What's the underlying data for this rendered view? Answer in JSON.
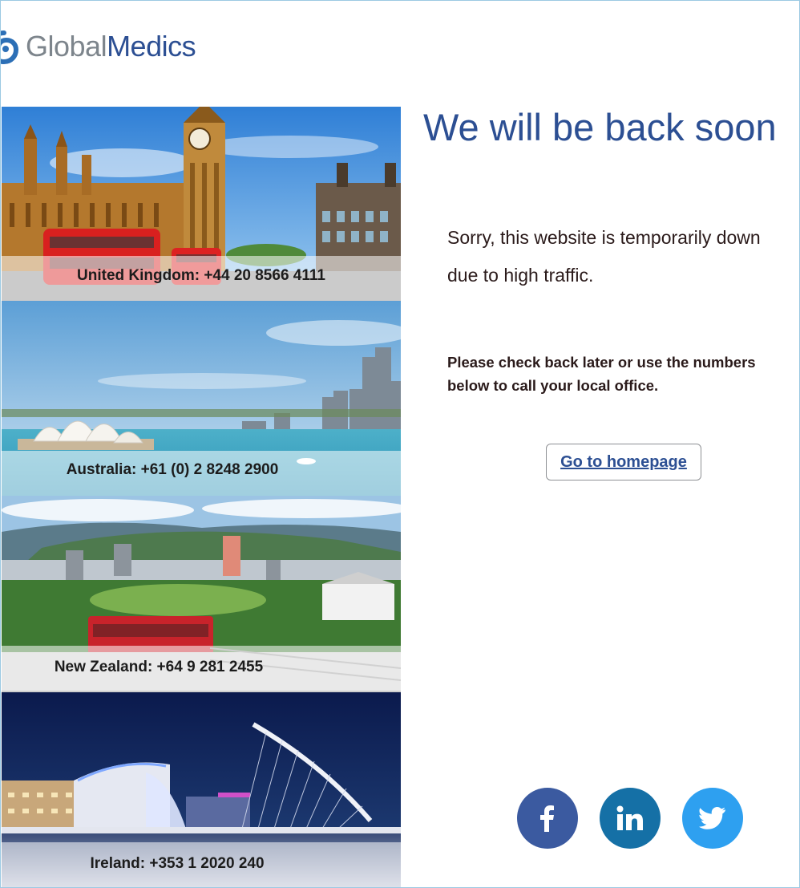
{
  "brand": {
    "name_part1": "Global",
    "name_part2": "Medics",
    "logo_icon": "globalmedics-logo-icon"
  },
  "offices": [
    {
      "label": "United Kingdom: +44 20 8566 4111"
    },
    {
      "label": "Australia: +61 (0) 2 8248 2900"
    },
    {
      "label": "New Zealand: +64 9 281 2455"
    },
    {
      "label": "Ireland: +353 1 2020 240"
    }
  ],
  "main": {
    "headline": "We will be back soon",
    "message_line1": "Sorry, this website is temporarily down",
    "message_line2": "due to high traffic.",
    "instruction_line1": "Please check back later or use the numbers",
    "instruction_line2": "below to call your local office.",
    "home_button": "Go to homepage"
  },
  "social": [
    {
      "icon": "facebook-icon",
      "glyph": "f",
      "color": "#3b5aa0"
    },
    {
      "icon": "linkedin-icon",
      "glyph": "in",
      "color": "#1570a6"
    },
    {
      "icon": "twitter-icon",
      "glyph": "",
      "color": "#2ea0f0"
    }
  ],
  "colors": {
    "brand_blue": "#2c4f93",
    "brand_grey": "#7d858c",
    "text_dark": "#2a1a1a"
  }
}
